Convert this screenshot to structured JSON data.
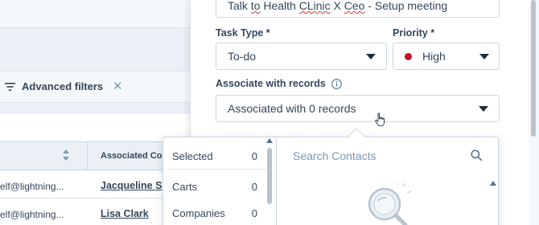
{
  "background": {
    "advanced_filters_label": "Advanced filters",
    "advanced_filters_close": "✕",
    "column_header": "Associated Con",
    "rows": [
      {
        "email": "elf@lightning...",
        "contact": "Jacqueline S"
      },
      {
        "email": "elf@lightning...",
        "contact": "Lisa Clark"
      }
    ]
  },
  "task_form": {
    "title_parts": [
      "Talk ",
      "to",
      " Health ",
      "CLinic",
      " X ",
      "Ceo",
      " - Setup meeting"
    ],
    "task_type": {
      "label": "Task Type *",
      "value": "To-do"
    },
    "priority": {
      "label": "Priority *",
      "value": "High",
      "color": "#c8102e"
    },
    "associate": {
      "label": "Associate with records",
      "value": "Associated with 0 records"
    }
  },
  "association_dropdown": {
    "categories": [
      {
        "label": "Selected",
        "count": "0"
      },
      {
        "label": "Carts",
        "count": "0"
      },
      {
        "label": "Companies",
        "count": "0"
      }
    ],
    "search_placeholder": "Search Contacts"
  },
  "colors": {
    "text": "#33475b",
    "border": "#cbd6e2",
    "panel_bg": "#ffffff",
    "page_bg": "#f5f8fa",
    "priority_high": "#c8102e"
  },
  "icons": [
    "filter-icon",
    "close-icon",
    "sort-icon",
    "chevron-down-icon",
    "info-icon",
    "cursor-icon",
    "search-icon",
    "magnifier-illustration"
  ]
}
